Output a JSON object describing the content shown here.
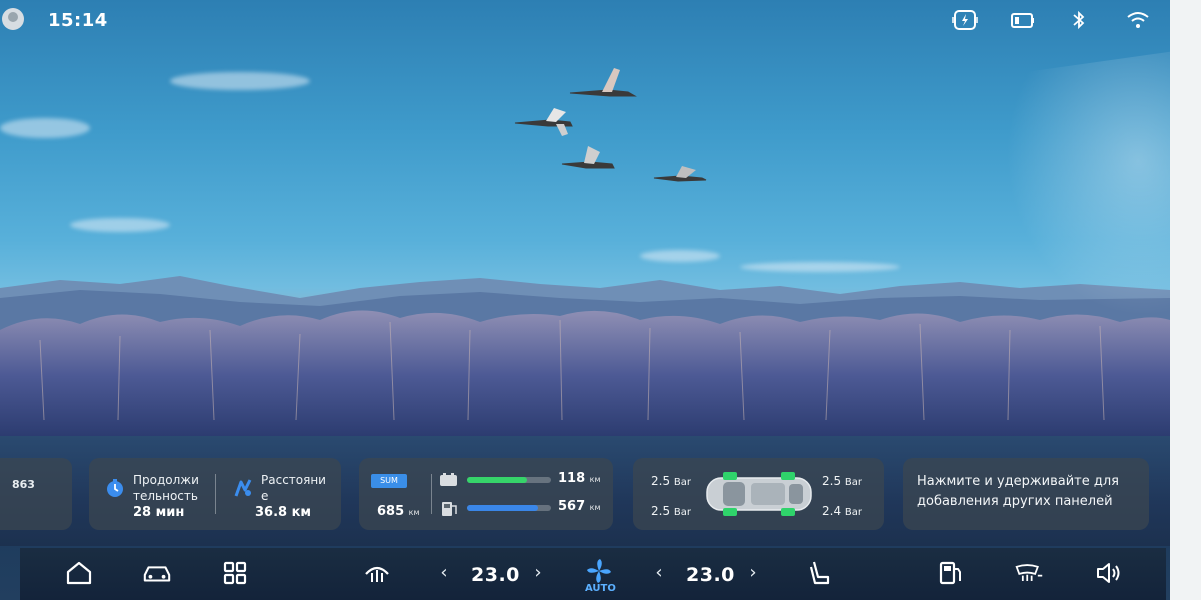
{
  "status_bar": {
    "time": "15:14",
    "icons": [
      "user-avatar",
      "wireless-charging-icon",
      "battery-icon",
      "bluetooth-icon",
      "wifi-icon"
    ]
  },
  "widgets": {
    "partial": {
      "value": "863"
    },
    "trip": {
      "duration_label": "Продолжительность",
      "duration_label_line1": "Продолжи",
      "duration_label_line2": "тельность",
      "duration_value": "28 мин",
      "distance_label_line1": "Расстояни",
      "distance_label_line2": "е",
      "distance_value": "36.8 км"
    },
    "range": {
      "badge": "SUM",
      "total_value": "685",
      "total_unit": "км",
      "battery_value": "118",
      "battery_unit": "км",
      "battery_fill": 0.72,
      "fuel_value": "567",
      "fuel_unit": "км",
      "fuel_fill": 0.85,
      "colors": {
        "battery": "#36d46a",
        "fuel": "#3a86e8"
      }
    },
    "tires": {
      "front_left": "2.5",
      "front_right": "2.5",
      "rear_left": "2.5",
      "rear_right": "2.4",
      "unit": "Bar"
    },
    "hint": {
      "text": "Нажмите и удерживайте для добавления других панелей"
    }
  },
  "dock": {
    "icons": [
      "home-icon",
      "car-icon",
      "apps-grid-icon",
      "rear-defrost-icon",
      "fan-icon",
      "seat-heat-icon",
      "fuel-station-icon",
      "front-defrost-icon",
      "volume-icon"
    ],
    "temp_left": "23.0",
    "temp_right": "23.0",
    "auto_label": "AUTO",
    "left_arrow": "‹",
    "right_arrow": "›"
  }
}
